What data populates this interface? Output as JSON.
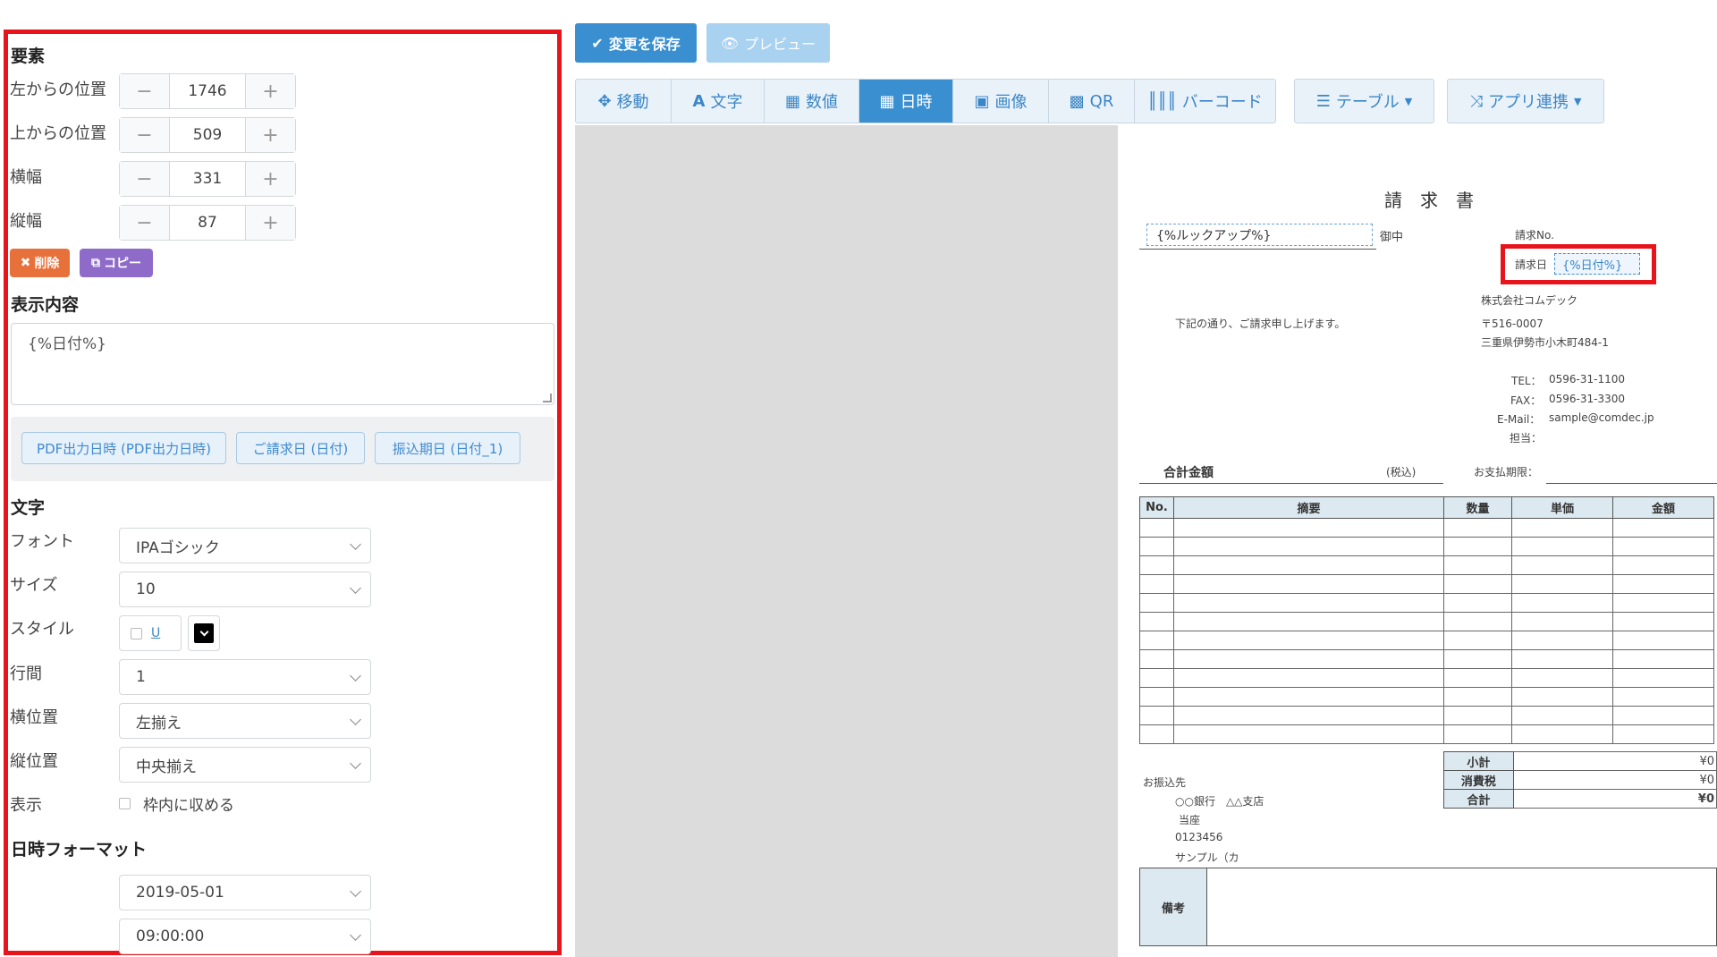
{
  "left_panel": {
    "element_heading": "要素",
    "fields": [
      {
        "label": "左からの位置",
        "value": "1746"
      },
      {
        "label": "上からの位置",
        "value": "509"
      },
      {
        "label": "横幅",
        "value": "331"
      },
      {
        "label": "縦幅",
        "value": "87"
      }
    ],
    "stepper_minus": "−",
    "stepper_plus": "+",
    "delete_label": "削除",
    "copy_label": "コピー",
    "content_heading": "表示内容",
    "content_value": "{%日付%}",
    "variables": [
      "PDF出力日時 (PDF出力日時)",
      "ご請求日 (日付)",
      "振込期日 (日付_1)"
    ],
    "text_heading": "文字",
    "font_label": "フォント",
    "font_value": "IPAゴシック",
    "size_label": "サイズ",
    "size_value": "10",
    "style_label": "スタイル",
    "underline_label": "U",
    "line_spacing_label": "行間",
    "line_spacing_value": "1",
    "halign_label": "横位置",
    "halign_value": "左揃え",
    "valign_label": "縦位置",
    "valign_value": "中央揃え",
    "display_label": "表示",
    "fit_label": "枠内に収める",
    "date_format_heading": "日時フォーマット",
    "date_format_value": "2019-05-01",
    "time_format_value": "09:00:00"
  },
  "toolbar": {
    "save_label": "変更を保存",
    "preview_label": "プレビュー",
    "tabs": [
      {
        "label": "移動",
        "icon": "move-icon"
      },
      {
        "label": "文字",
        "icon": "text-icon"
      },
      {
        "label": "数値",
        "icon": "calculator-icon"
      },
      {
        "label": "日時",
        "icon": "calendar-icon"
      },
      {
        "label": "画像",
        "icon": "image-icon"
      },
      {
        "label": "QR",
        "icon": "qr-icon"
      },
      {
        "label": "バーコード",
        "icon": "barcode-icon"
      }
    ],
    "active_tab": "日時",
    "table_label": "テーブル",
    "app_link_label": "アプリ連携"
  },
  "document": {
    "title": "請　求　書",
    "customer_field": "{%ルックアップ%}",
    "honorific": "御中",
    "invoice_no_label": "請求No.",
    "invoice_date_label": "請求日",
    "invoice_date_field": "{%日付%}",
    "greeting": "下記の通り、ご請求申し上げます。",
    "company": "株式会社コムデック",
    "postal": "〒516-0007",
    "address": "三重県伊勢市小木町484-1",
    "tel_label": "TEL：",
    "tel": "0596-31-1100",
    "fax_label": "FAX：",
    "fax": "0596-31-3300",
    "email_label": "E-Mail：",
    "email": "sample@comdec.jp",
    "staff_label": "担当：",
    "total_label": "合計金額",
    "tax_incl": "(税込)",
    "due_label": "お支払期限：",
    "columns": [
      "No.",
      "摘要",
      "数量",
      "単価",
      "金額"
    ],
    "row_count": 12,
    "summary": [
      {
        "label": "小計",
        "value": "¥0"
      },
      {
        "label": "消費税",
        "value": "¥0"
      },
      {
        "label": "合計",
        "value": "¥0"
      }
    ],
    "transfer_label": "お振込先",
    "bank": "○○銀行　△△支店",
    "account_type": "当座",
    "account_no": "0123456",
    "account_name": "サンプル（カ",
    "remarks_label": "備考"
  },
  "colors": {
    "highlight": "#e8141b",
    "accent": "#3a8fd0",
    "delete": "#e8703a",
    "copy": "#8e6bc9"
  }
}
